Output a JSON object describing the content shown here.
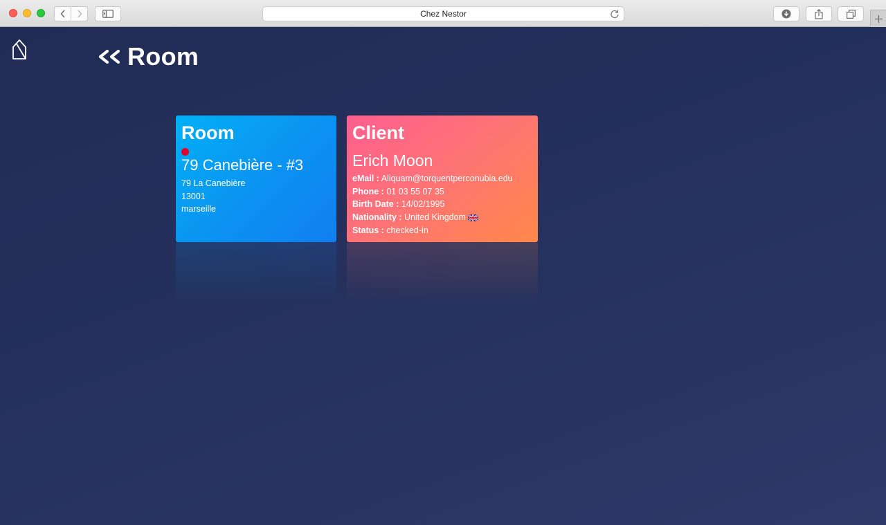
{
  "browser": {
    "url_title": "Chez Nestor",
    "traffic_lights": {
      "close": "#fe5f57",
      "minimize": "#febc2e",
      "maximize": "#28c840"
    },
    "icons": [
      "chevron-left-icon",
      "chevron-right-icon",
      "sidebar-icon",
      "reload-icon",
      "download-icon",
      "share-icon",
      "tabs-icon",
      "plus-icon"
    ]
  },
  "header": {
    "back_label": "«",
    "title": "Room",
    "logo_icon": "house-logo-icon"
  },
  "room_card": {
    "title": "Room",
    "status_color": "#e5002b",
    "name": "79 Canebière - #3",
    "street": "79 La Canebière",
    "postal_code": "13001",
    "city": "marseille",
    "colors": {
      "from": "#02b0f6",
      "to": "#117ef0"
    }
  },
  "client_card": {
    "title": "Client",
    "name": "Erich Moon",
    "email_label": "eMail :",
    "email": "Aliquam@torquentperconubia.edu",
    "phone_label": "Phone :",
    "phone": "01 03 55 07 35",
    "birth_label": "Birth Date :",
    "birth_date": "14/02/1995",
    "nationality_label": "Nationality :",
    "nationality": "United Kingdom",
    "status_label": "Status :",
    "status": "checked-in",
    "colors": {
      "from": "#ff5f8f",
      "to": "#ff8848"
    }
  },
  "theme": {
    "background": "#24305a"
  }
}
